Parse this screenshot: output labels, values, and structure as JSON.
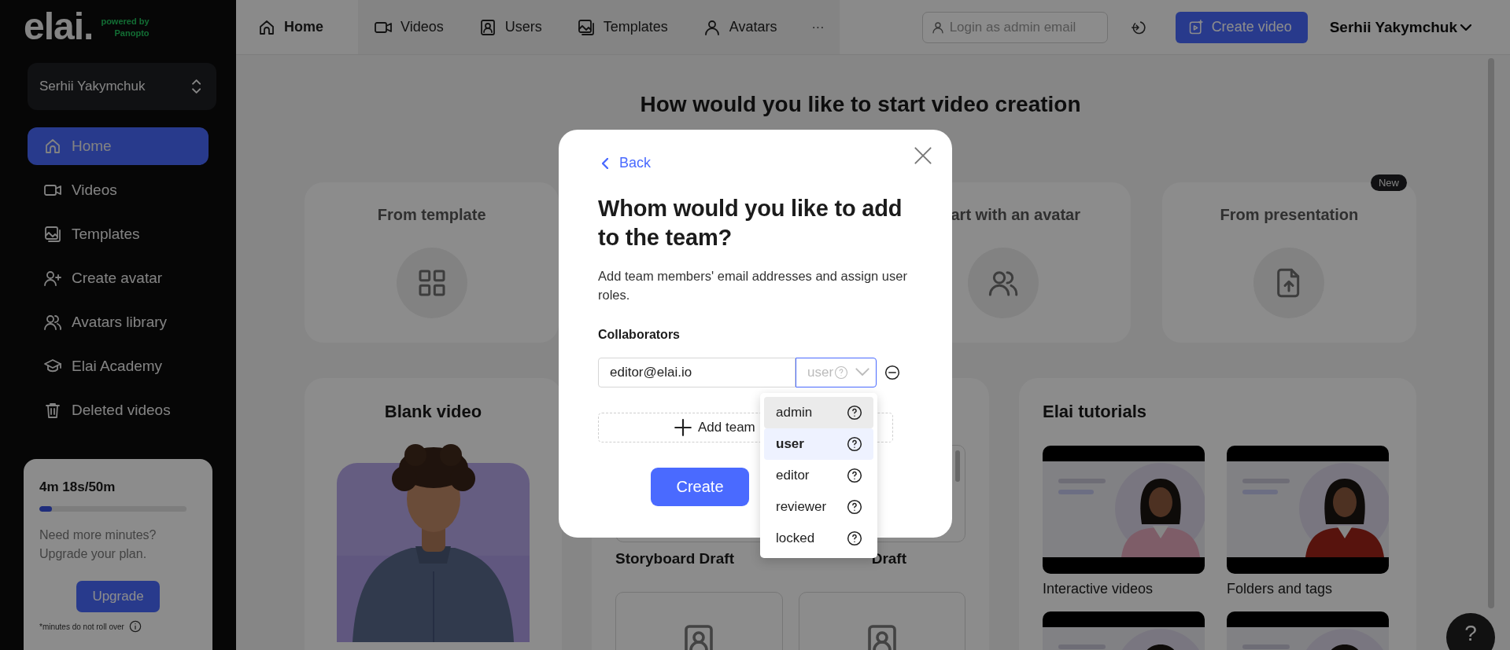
{
  "logo": {
    "wordmark": "elai.",
    "powered_by": "powered by",
    "partner": "Panopto"
  },
  "workspace": {
    "label": "Serhii Yakymchuk"
  },
  "sidebar": {
    "items": [
      {
        "label": "Home",
        "selected": true
      },
      {
        "label": "Videos",
        "selected": false
      },
      {
        "label": "Templates",
        "selected": false
      },
      {
        "label": "Create avatar",
        "selected": false
      },
      {
        "label": "Avatars library",
        "selected": false
      },
      {
        "label": "Elai Academy",
        "selected": false
      },
      {
        "label": "Deleted videos",
        "selected": false
      }
    ]
  },
  "usage": {
    "reading": "4m 18s/50m",
    "level": 0.085,
    "message": "Need more minutes? Upgrade your plan.",
    "button": "Upgrade",
    "footnote": "*minutes do not roll over"
  },
  "topbar": {
    "tabs": [
      {
        "label": "Home",
        "selected": true
      },
      {
        "label": "Videos",
        "selected": false
      },
      {
        "label": "Users",
        "selected": false
      },
      {
        "label": "Templates",
        "selected": false
      },
      {
        "label": "Avatars",
        "selected": false
      }
    ],
    "more": "···",
    "search": {
      "placeholder": "Login as admin email"
    },
    "create_button": "Create video",
    "account": "Serhii Yakymchuk"
  },
  "main": {
    "heading": "How would you like to start video creation",
    "start_cards": [
      {
        "title": "From template"
      },
      {
        "title": "art with an avatar"
      },
      {
        "title": "From presentation",
        "badge": "New"
      }
    ],
    "blank_video": {
      "title": "Blank video"
    },
    "storyboards": [
      {
        "title": "Storyboard Draft"
      },
      {
        "title": "Draft"
      }
    ],
    "tutorials": {
      "title": "Elai tutorials",
      "videos": [
        {
          "kind": "video",
          "title": "Interactive videos"
        },
        {
          "kind": "video",
          "title": "Folders and tags"
        },
        {
          "kind": "picture"
        },
        {
          "kind": "picture"
        }
      ]
    }
  },
  "help": "?",
  "modal": {
    "back": "Back",
    "title": "Whom would you like to add to the team?",
    "description": "Add team members' email addresses and assign user roles.",
    "collaborators_label": "Collaborators",
    "collaborators": [
      {
        "email": "editor@elai.io",
        "role": "user"
      }
    ],
    "role_menu": {
      "expanded": true,
      "options": [
        {
          "label": "admin",
          "hovered": true,
          "selected": false
        },
        {
          "label": "user",
          "hovered": false,
          "selected": true
        },
        {
          "label": "editor",
          "hovered": false,
          "selected": false
        },
        {
          "label": "reviewer",
          "hovered": false,
          "selected": false
        },
        {
          "label": "locked",
          "hovered": false,
          "selected": false
        }
      ]
    },
    "add_button": "Add team",
    "create_button": "Create"
  }
}
